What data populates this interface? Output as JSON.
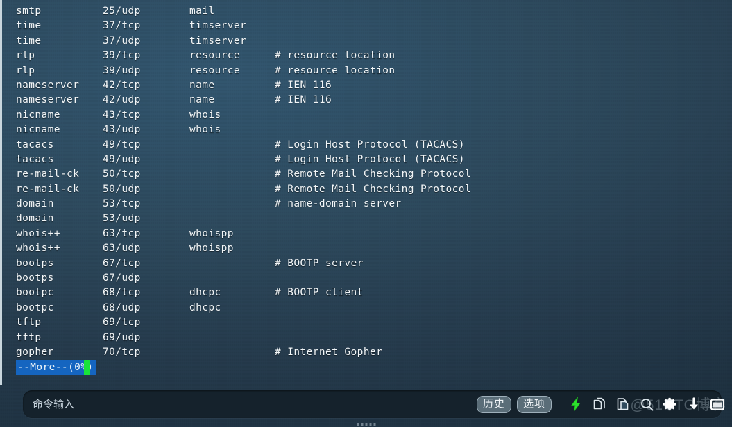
{
  "terminal": {
    "lines": [
      {
        "name": "smtp",
        "port": "25/udp",
        "alias": "mail",
        "comment": ""
      },
      {
        "name": "time",
        "port": "37/tcp",
        "alias": "timserver",
        "comment": ""
      },
      {
        "name": "time",
        "port": "37/udp",
        "alias": "timserver",
        "comment": ""
      },
      {
        "name": "rlp",
        "port": "39/tcp",
        "alias": "resource",
        "comment": "# resource location"
      },
      {
        "name": "rlp",
        "port": "39/udp",
        "alias": "resource",
        "comment": "# resource location"
      },
      {
        "name": "nameserver",
        "port": "42/tcp",
        "alias": "name",
        "comment": "# IEN 116"
      },
      {
        "name": "nameserver",
        "port": "42/udp",
        "alias": "name",
        "comment": "# IEN 116"
      },
      {
        "name": "nicname",
        "port": "43/tcp",
        "alias": "whois",
        "comment": ""
      },
      {
        "name": "nicname",
        "port": "43/udp",
        "alias": "whois",
        "comment": ""
      },
      {
        "name": "tacacs",
        "port": "49/tcp",
        "alias": "",
        "comment": "# Login Host Protocol (TACACS)"
      },
      {
        "name": "tacacs",
        "port": "49/udp",
        "alias": "",
        "comment": "# Login Host Protocol (TACACS)"
      },
      {
        "name": "re-mail-ck",
        "port": "50/tcp",
        "alias": "",
        "comment": "# Remote Mail Checking Protocol"
      },
      {
        "name": "re-mail-ck",
        "port": "50/udp",
        "alias": "",
        "comment": "# Remote Mail Checking Protocol"
      },
      {
        "name": "domain",
        "port": "53/tcp",
        "alias": "",
        "comment": "# name-domain server"
      },
      {
        "name": "domain",
        "port": "53/udp",
        "alias": "",
        "comment": ""
      },
      {
        "name": "whois++",
        "port": "63/tcp",
        "alias": "whoispp",
        "comment": ""
      },
      {
        "name": "whois++",
        "port": "63/udp",
        "alias": "whoispp",
        "comment": ""
      },
      {
        "name": "bootps",
        "port": "67/tcp",
        "alias": "",
        "comment": "# BOOTP server"
      },
      {
        "name": "bootps",
        "port": "67/udp",
        "alias": "",
        "comment": ""
      },
      {
        "name": "bootpc",
        "port": "68/tcp",
        "alias": "dhcpc",
        "comment": "# BOOTP client"
      },
      {
        "name": "bootpc",
        "port": "68/udp",
        "alias": "dhcpc",
        "comment": ""
      },
      {
        "name": "tftp",
        "port": "69/tcp",
        "alias": "",
        "comment": ""
      },
      {
        "name": "tftp",
        "port": "69/udp",
        "alias": "",
        "comment": ""
      },
      {
        "name": "gopher",
        "port": "70/tcp",
        "alias": "",
        "comment": "# Internet Gopher"
      }
    ],
    "more_prompt": "--More--(0%)",
    "cursor": "block",
    "colors": {
      "text": "#f2f6f8",
      "more_background": "#1565c0",
      "cursor": "#19e33a",
      "background": "#2b4659"
    }
  },
  "command_bar": {
    "placeholder": "命令输入",
    "value": ""
  },
  "toolbar": {
    "buttons": [
      {
        "label": "历史",
        "name": "history-button"
      },
      {
        "label": "选项",
        "name": "options-button"
      }
    ],
    "icons": [
      {
        "name": "lightning-bolt-icon",
        "color": "#2ce02c"
      },
      {
        "name": "copy-icon",
        "color": "#dfe8ee"
      },
      {
        "name": "paste-icon",
        "color": "#dfe8ee"
      },
      {
        "name": "search-icon",
        "color": "#dfe8ee"
      },
      {
        "name": "gear-icon",
        "color": "#ffffff"
      },
      {
        "name": "download-icon",
        "color": "#ffffff"
      },
      {
        "name": "window-icon",
        "color": "#ffffff"
      }
    ]
  },
  "watermark": {
    "text": "@51CTO博客"
  }
}
